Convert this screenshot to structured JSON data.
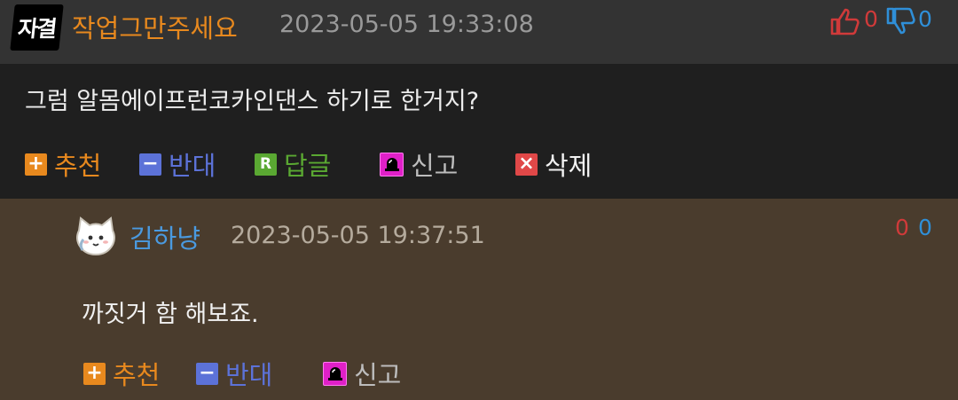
{
  "main_comment": {
    "avatar_text": "자결",
    "username": "작업그만주세요",
    "timestamp": "2023-05-05 19:33:08",
    "upvotes": "0",
    "downvotes": "0",
    "content": "그럼 알몸에이프런코카인댄스 하기로 한거지?",
    "actions": {
      "recommend": "추천",
      "oppose": "반대",
      "reply": "답글",
      "report": "신고",
      "delete": "삭제"
    },
    "action_icons": {
      "recommend": "+",
      "oppose": "−",
      "reply": "R",
      "delete": "×"
    }
  },
  "reply_comment": {
    "username": "김하냥",
    "timestamp": "2023-05-05 19:37:51",
    "upvotes": "0",
    "downvotes": "0",
    "content": "까짓거 함 해보죠.",
    "actions": {
      "recommend": "추천",
      "oppose": "반대",
      "report": "신고"
    }
  },
  "colors": {
    "username_main": "#e8891e",
    "username_reply": "#4a9ae0",
    "upvote": "#d03a3a",
    "downvote": "#2f8fd8",
    "recommend": "#e8891e",
    "oppose": "#5c72d8",
    "reply": "#5aa832",
    "report": "#bdbdbd",
    "delete": "#e04848",
    "header_bg": "#333333",
    "body_bg": "#1f1f1f",
    "reply_bg": "#4a3c2d"
  },
  "icons": [
    "thumbs-up-icon",
    "thumbs-down-icon",
    "plus-icon",
    "minus-icon",
    "reply-icon",
    "siren-icon",
    "delete-x-icon",
    "cat-avatar-icon"
  ]
}
